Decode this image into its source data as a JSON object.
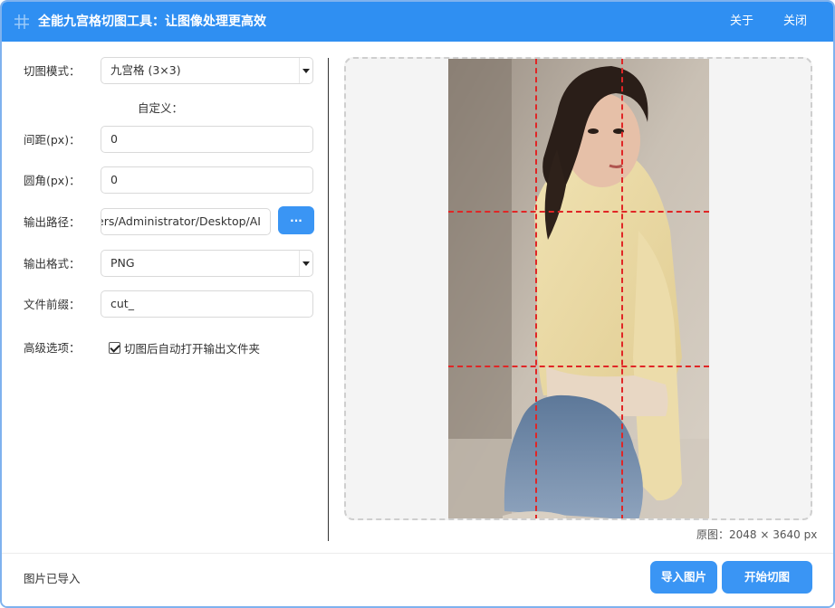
{
  "window": {
    "title": "全能九宫格切图工具：让图像处理更高效",
    "menu": {
      "about": "关于",
      "close": "关闭"
    }
  },
  "form": {
    "mode": {
      "label": "切图模式：",
      "value": "九宫格 (3×3)"
    },
    "custom": {
      "label": "自定义："
    },
    "spacing": {
      "label": "间距(px)：",
      "value": "0"
    },
    "radius": {
      "label": "圆角(px)：",
      "value": "0"
    },
    "output_path": {
      "label": "输出路径：",
      "value": "C:/Users/Administrator/Desktop/AI",
      "browse_label": "..."
    },
    "format": {
      "label": "输出格式：",
      "value": "PNG"
    },
    "prefix": {
      "label": "文件前缀：",
      "value": "cut_"
    },
    "advanced": {
      "label": "高级选项：",
      "open_folder_label": "切图后自动打开输出文件夹",
      "open_folder_checked": true
    }
  },
  "preview": {
    "original_size": "原图：2048 × 3640 px",
    "grid": {
      "rows": 3,
      "cols": 3,
      "line_color": "#e02626"
    }
  },
  "footer": {
    "status": "图片已导入",
    "import_button": "导入图片",
    "start_button": "开始切图"
  },
  "colors": {
    "accent": "#2f8ff2",
    "button": "#3a95f4"
  }
}
